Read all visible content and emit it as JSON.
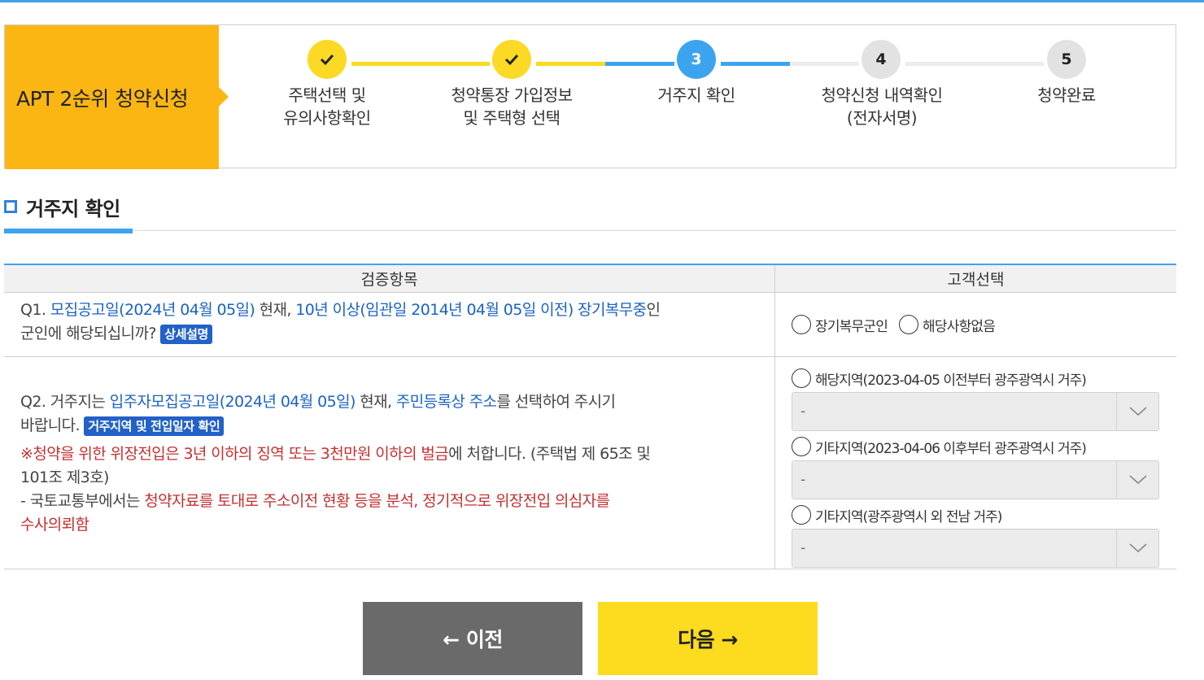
{
  "stepper": {
    "title": "APT 2순위 청약신청",
    "steps": [
      {
        "num": "",
        "state": "done",
        "label_line1": "주택선택 및",
        "label_line2": "유의사항확인"
      },
      {
        "num": "",
        "state": "done",
        "label_line1": "청약통장 가입정보",
        "label_line2": "및 주택형 선택"
      },
      {
        "num": "3",
        "state": "active",
        "label_line1": "거주지 확인",
        "label_line2": ""
      },
      {
        "num": "4",
        "state": "todo",
        "label_line1": "청약신청 내역확인",
        "label_line2": "(전자서명)"
      },
      {
        "num": "5",
        "state": "todo",
        "label_line1": "청약완료",
        "label_line2": ""
      }
    ],
    "colors": {
      "title_bg": "#fbb613",
      "done": "#fcd924",
      "active": "#3ca4ef",
      "todo": "#e2e2e2"
    }
  },
  "section": {
    "title": "거주지 확인"
  },
  "table": {
    "headers": {
      "item": "검증항목",
      "choice": "고객선택"
    },
    "q1": {
      "prefix": "Q1. ",
      "link1": "모집공고일(2024년 04월 05일)",
      "mid1": " 현재, ",
      "link2": "10년 이상(임관일 2014년 04월 05일 이전) 장기복무중",
      "mid2": "인",
      "line2": "군인에 해당되십니까? ",
      "badge": "상세설명",
      "options": [
        "장기복무군인",
        "해당사항없음"
      ]
    },
    "q2": {
      "prefix": "Q2. 거주지는 ",
      "link1": "입주자모집공고일(2024년 04월 05일)",
      "mid1": " 현재, ",
      "link2": "주민등록상 주소",
      "mid2": "를 선택하여 주시기",
      "line2": "바랍니다. ",
      "badge": "거주지역 및 전입일자 확인",
      "warn_prefix": "※",
      "warn_red": "청약을 위한 위장전입은 3년 이하의 징역 또는 3천만원 이하의 벌금",
      "warn_rest": "에 처합니다. (주택법 제 65조 및",
      "warn_line2": "101조 제3호)",
      "note_prefix": "- 국토교통부에서는 ",
      "note_red1": "청약자료를 토대로 주소이전 현황 등을 분석, 정기적으로 위장전입 의심자를",
      "note_red2": "수사의뢰함",
      "options": [
        {
          "label": "해당지역(2023-04-05 이전부터 광주광역시 거주)",
          "select": "-"
        },
        {
          "label": "기타지역(2023-04-06 이후부터 광주광역시 거주)",
          "select": "-"
        },
        {
          "label": "기타지역(광주광역시 외 전남 거주)",
          "select": "-"
        }
      ]
    }
  },
  "buttons": {
    "prev": "← 이전",
    "next": "다음 →"
  }
}
